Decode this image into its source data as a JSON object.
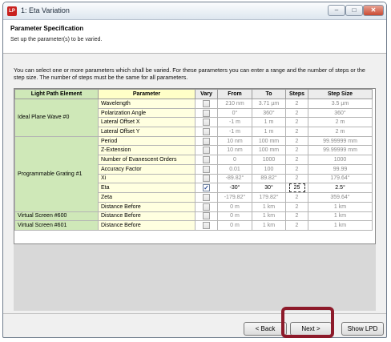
{
  "window": {
    "app_icon": "LP",
    "title": "1: Eta Variation",
    "min_symbol": "–",
    "max_symbol": "□",
    "close_symbol": "✕"
  },
  "header": {
    "title": "Parameter Specification",
    "subtitle": "Set up the parameter(s) to be varied."
  },
  "intro": "You can select one or more parameters which shall be varied. For these parameters you can enter a range and the number of steps or the step size. The number of steps must be the same for all parameters.",
  "table": {
    "columns": [
      "Light Path Element",
      "Parameter",
      "Vary",
      "From",
      "To",
      "Steps",
      "Step Size"
    ],
    "groups": [
      {
        "element": "Ideal Plane Wave #0",
        "rows": [
          {
            "param": "Wavelength",
            "vary": false,
            "from": "210 nm",
            "to": "3.71 µm",
            "steps": "2",
            "size": "3.5 µm"
          },
          {
            "param": "Polarization Angle",
            "vary": false,
            "from": "0°",
            "to": "360°",
            "steps": "2",
            "size": "360°"
          },
          {
            "param": "Lateral Offset X",
            "vary": false,
            "from": "-1 m",
            "to": "1 m",
            "steps": "2",
            "size": "2 m"
          },
          {
            "param": "Lateral Offset Y",
            "vary": false,
            "from": "-1 m",
            "to": "1 m",
            "steps": "2",
            "size": "2 m"
          }
        ]
      },
      {
        "element": "Programmable Grating #1",
        "rows": [
          {
            "param": "Period",
            "vary": false,
            "from": "10 nm",
            "to": "100 mm",
            "steps": "2",
            "size": "99.99999 mm"
          },
          {
            "param": "Z-Extension",
            "vary": false,
            "from": "10 nm",
            "to": "100 mm",
            "steps": "2",
            "size": "99.99999 mm"
          },
          {
            "param": "Number of Evanescent Orders",
            "vary": false,
            "from": "0",
            "to": "1000",
            "steps": "2",
            "size": "1000"
          },
          {
            "param": "Accuracy Factor",
            "vary": false,
            "from": "0.01",
            "to": "100",
            "steps": "2",
            "size": "99.99"
          },
          {
            "param": "Xi",
            "vary": false,
            "from": "-89.82°",
            "to": "89.82°",
            "steps": "2",
            "size": "179.64°"
          },
          {
            "param": "Eta",
            "vary": true,
            "from": "-30°",
            "to": "30°",
            "steps": "25",
            "size": "2.5°"
          },
          {
            "param": "Zeta",
            "vary": false,
            "from": "-179.82°",
            "to": "179.82°",
            "steps": "2",
            "size": "359.64°"
          },
          {
            "param": "Distance Before",
            "vary": false,
            "from": "0 m",
            "to": "1 km",
            "steps": "2",
            "size": "1 km"
          }
        ]
      },
      {
        "element": "Virtual Screen #600",
        "rows": [
          {
            "param": "Distance Before",
            "vary": false,
            "from": "0 m",
            "to": "1 km",
            "steps": "2",
            "size": "1 km"
          }
        ]
      },
      {
        "element": "Virtual Screen #601",
        "rows": [
          {
            "param": "Distance Before",
            "vary": false,
            "from": "0 m",
            "to": "1 km",
            "steps": "2",
            "size": "1 km"
          }
        ]
      }
    ]
  },
  "footer": {
    "back_label": "< Back",
    "next_label": "Next >",
    "show_label": "Show LPD"
  },
  "colors": {
    "element_bg": "#cfe8b8",
    "param_bg": "#ffffe0",
    "highlight": "#8d1a2a"
  }
}
